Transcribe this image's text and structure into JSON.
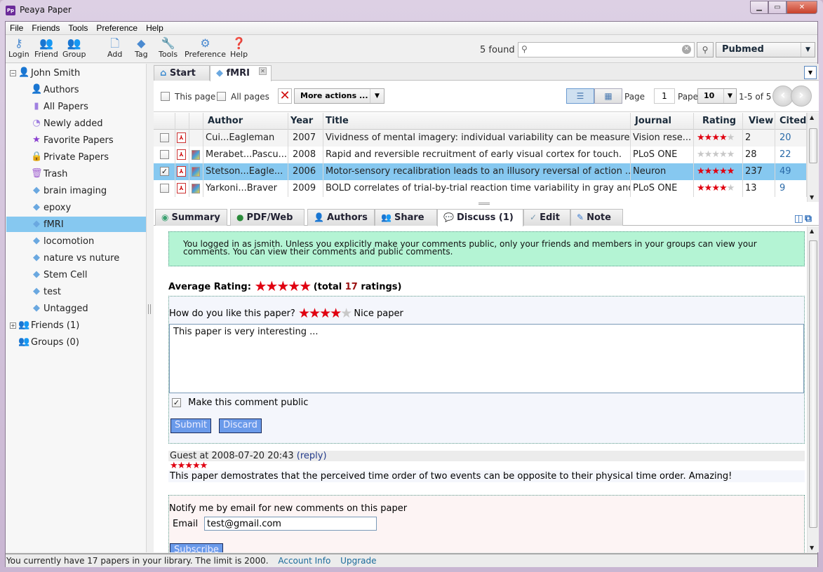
{
  "window": {
    "title": "Peaya Paper",
    "app_icon": "Pp"
  },
  "menu": [
    "File",
    "Friends",
    "Tools",
    "Preference",
    "Help"
  ],
  "toolbar": [
    {
      "label": "Login",
      "icon": "key-icon"
    },
    {
      "label": "Friend",
      "icon": "friends-icon"
    },
    {
      "label": "Group",
      "icon": "group-icon"
    },
    {
      "label": "Add",
      "icon": "add-document-icon"
    },
    {
      "label": "Tag",
      "icon": "tag-icon"
    },
    {
      "label": "Tools",
      "icon": "wrench-icon"
    },
    {
      "label": "Preference",
      "icon": "gear-icon"
    },
    {
      "label": "Help",
      "icon": "help-icon"
    }
  ],
  "search": {
    "found": "5 found",
    "value": "",
    "source": "Pubmed"
  },
  "sidebar": {
    "user": "John Smith",
    "items": [
      {
        "label": "Authors",
        "icon": "author-icon"
      },
      {
        "label": "All Papers",
        "icon": "papers-icon"
      },
      {
        "label": "Newly added",
        "icon": "clock-icon"
      },
      {
        "label": "Favorite Papers",
        "icon": "star-icon"
      },
      {
        "label": "Private Papers",
        "icon": "lock-icon"
      },
      {
        "label": "Trash",
        "icon": "trash-icon"
      },
      {
        "label": "brain imaging",
        "icon": "tag-icon"
      },
      {
        "label": "epoxy",
        "icon": "tag-icon"
      },
      {
        "label": "fMRI",
        "icon": "tag-icon",
        "selected": true
      },
      {
        "label": "locomotion",
        "icon": "tag-icon"
      },
      {
        "label": "nature vs nuture",
        "icon": "tag-icon"
      },
      {
        "label": "Stem Cell",
        "icon": "tag-icon"
      },
      {
        "label": "test",
        "icon": "tag-icon"
      },
      {
        "label": "Untagged",
        "icon": "tag-icon"
      }
    ],
    "friends": "Friends (1)",
    "groups": "Groups (0)"
  },
  "tabs": [
    {
      "label": "Start"
    },
    {
      "label": "fMRI",
      "active": true
    }
  ],
  "actions": {
    "this_page": "This page",
    "all_pages": "All pages",
    "more_actions": "More actions ...",
    "page_label": "Page",
    "page": "1",
    "papers_label": "Papers",
    "per_page": "10",
    "range": "1-5 of 5"
  },
  "table": {
    "columns": [
      "Author",
      "Year",
      "Title",
      "Journal",
      "Rating",
      "View",
      "Cited"
    ],
    "rows": [
      {
        "checked": false,
        "pdf": true,
        "web": false,
        "author": "Cui...Eagleman",
        "year": "2007",
        "title": "Vividness of mental imagery: individual variability can be measure...",
        "journal": "Vision rese...",
        "rating": 4,
        "view": "2",
        "cited": "20"
      },
      {
        "checked": false,
        "pdf": true,
        "web": true,
        "author": "Merabet...Pascu...",
        "year": "2008",
        "title": "Rapid and reversible recruitment of early visual cortex for touch.",
        "journal": "PLoS ONE",
        "rating": 0,
        "view": "28",
        "cited": "22"
      },
      {
        "checked": true,
        "pdf": true,
        "web": true,
        "author": "Stetson...Eagle...",
        "year": "2006",
        "title": "Motor-sensory recalibration leads to an illusory reversal of action ...",
        "journal": "Neuron",
        "rating": 5,
        "view": "237",
        "cited": "49",
        "selected": true
      },
      {
        "checked": false,
        "pdf": true,
        "web": true,
        "author": "Yarkoni...Braver",
        "year": "2009",
        "title": "BOLD correlates of trial-by-trial reaction time variability in gray and...",
        "journal": "PLoS ONE",
        "rating": 4,
        "view": "13",
        "cited": "9"
      }
    ]
  },
  "detail_tabs": [
    {
      "label": "Summary",
      "icon": "summary-icon"
    },
    {
      "label": "PDF/Web",
      "icon": "globe-icon"
    },
    {
      "label": "Authors",
      "icon": "author-icon"
    },
    {
      "label": "Share",
      "icon": "share-icon"
    },
    {
      "label": "Discuss (1)",
      "icon": "comment-icon",
      "active": true
    },
    {
      "label": "Edit",
      "icon": "edit-icon"
    },
    {
      "label": "Note",
      "icon": "pencil-icon"
    }
  ],
  "discuss": {
    "notice_line1": "You logged in as jsmith. Unless you explicitly make your comments public, only your friends and members in your groups can view your",
    "notice_line2": "comments. You can view their comments and public comments.",
    "avg_label": "Average Rating:",
    "avg_rating": 5,
    "total_prefix": "(total ",
    "total_count": "17",
    "total_suffix": " ratings)",
    "question": "How do you like this paper?",
    "my_rating": 4,
    "rating_text": "Nice paper",
    "comment_value": "This paper is very interesting ...",
    "make_public_label": "Make this comment public",
    "make_public": true,
    "submit": "Submit",
    "discard": "Discard",
    "comments": [
      {
        "header": "Guest at 2008-07-20 20:43 ",
        "reply": "(reply)",
        "rating": 5,
        "body": "This paper demostrates that the perceived time order of two events can be opposite to their physical time order. Amazing!"
      }
    ],
    "notify_text": "Notify me by email for new comments on this paper",
    "email_label": "Email",
    "email_value": "test@gmail.com",
    "subscribe": "Subscribe"
  },
  "status": {
    "text": "You currently have 17 papers in your library. The limit is 2000.",
    "account_info": "Account Info",
    "upgrade": "Upgrade"
  }
}
